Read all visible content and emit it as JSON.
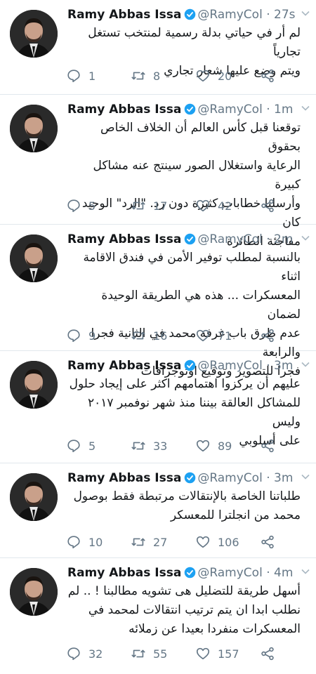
{
  "author": {
    "name": "Ramy Abbas Issa",
    "handle": "@RamyCol",
    "dot": "·"
  },
  "tweets": [
    {
      "time": "27s",
      "text": "لم أر في حياتي بدلة رسمية لمنتخب تستغل تجارياً\nويتم وضع عليها شعار تجاري",
      "replies": "1",
      "retweets": "8",
      "likes": "20"
    },
    {
      "time": "1m",
      "text": "توقعنا قبل كأس العالم أن الخلاف الخاص بحقوق\nالرعاية واستغلال الصور سينتج عنه مشاكل كبيرة\nوأرسلنا خطابات كثيرة دون رد. \"الرد\" الوحيد كان\nمفاجئة الطائرة",
      "replies": "5",
      "retweets": "17",
      "likes": "42"
    },
    {
      "time": "2m",
      "text": "بالنسبة لمطلب توفير الأمن في فندق الاقامة اثناء\nالمعسكرات ... هذه هي الطريقة الوحيدة لضمان\nعدم طرق باب غرفة محمد في الثانية فجرا والرابعة\nفجرا للتصوير وتوقيع اوتوجرافات",
      "replies": "9",
      "retweets": "16",
      "likes": "71"
    },
    {
      "time": "3m",
      "text": "عليهم أن يركزوا اهتمامهم اكثر على إيجاد حلول\nللمشاكل العالقة بيننا منذ شهر نوفمبر ٢٠١٧ وليس\nعلى أسلوبي",
      "replies": "5",
      "retweets": "33",
      "likes": "89"
    },
    {
      "time": "3m",
      "text": "طلباتنا الخاصة بالإنتقالات مرتبطة فقط بوصول\nمحمد من انجلترا للمعسكر",
      "replies": "10",
      "retweets": "27",
      "likes": "106"
    },
    {
      "time": "4m",
      "text": "أسهل طريقة للتضليل هى تشويه مطالبنا ! .. لم\nنطلب ابدا ان يتم ترتيب انتقالات لمحمد في\nالمعسكرات منفردا بعيدا عن زملائه",
      "replies": "32",
      "retweets": "55",
      "likes": "157"
    }
  ],
  "icons": {
    "reply": "reply-icon",
    "retweet": "retweet-icon",
    "like": "heart-icon",
    "share": "share-icon",
    "verified": "verified-badge-icon",
    "caret": "chevron-down-icon"
  },
  "colors": {
    "verified": "#1da1f2",
    "secondary_text": "#657786",
    "divider": "#e1e8ed"
  }
}
